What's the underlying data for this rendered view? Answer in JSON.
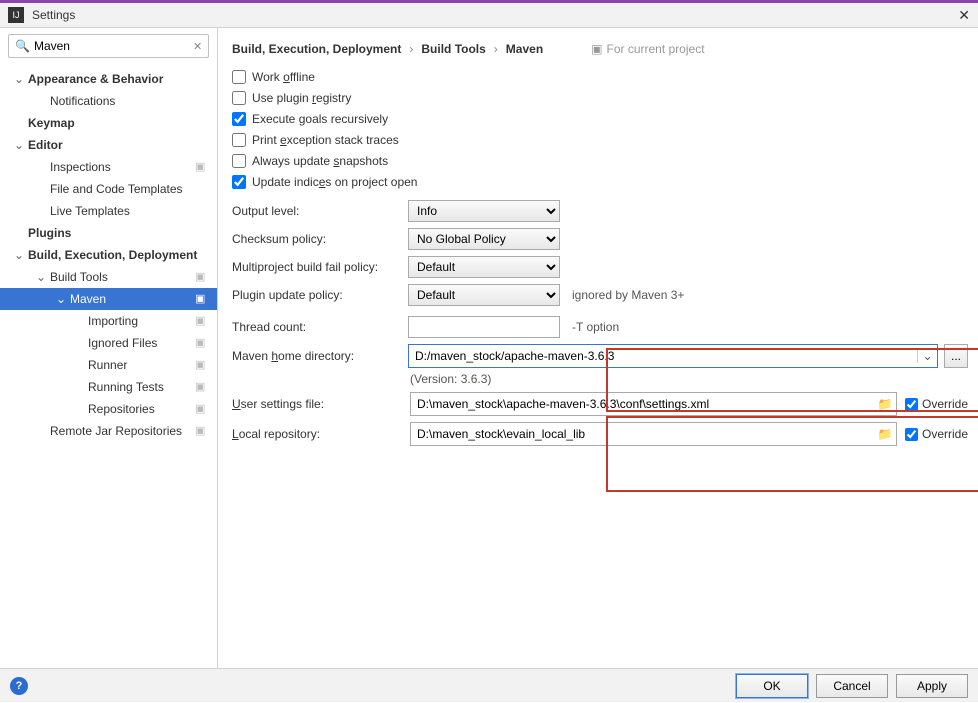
{
  "window": {
    "title": "Settings"
  },
  "search": {
    "value": "Maven",
    "placeholder": ""
  },
  "tree": {
    "appearance": "Appearance & Behavior",
    "notifications": "Notifications",
    "keymap": "Keymap",
    "editor": "Editor",
    "inspections": "Inspections",
    "file_templates": "File and Code Templates",
    "live_templates": "Live Templates",
    "plugins": "Plugins",
    "bed": "Build, Execution, Deployment",
    "build_tools": "Build Tools",
    "maven": "Maven",
    "importing": "Importing",
    "ignored": "Ignored Files",
    "runner": "Runner",
    "running_tests": "Running Tests",
    "repositories": "Repositories",
    "remote_jar": "Remote Jar Repositories"
  },
  "breadcrumb": {
    "b1": "Build, Execution, Deployment",
    "b2": "Build Tools",
    "b3": "Maven",
    "for_project": "For current project"
  },
  "checks": {
    "work_offline": "Work offline",
    "use_plugin_registry": "Use plugin registry",
    "execute_goals": "Execute goals recursively",
    "print_exception": "Print exception stack traces",
    "always_update": "Always update snapshots",
    "update_indices": "Update indices on project open"
  },
  "labels": {
    "output_level": "Output level:",
    "checksum_policy": "Checksum policy:",
    "multiproject": "Multiproject build fail policy:",
    "plugin_update": "Plugin update policy:",
    "thread_count": "Thread count:",
    "maven_home": "Maven home directory:",
    "user_settings": "User settings file:",
    "local_repo": "Local repository:",
    "override": "Override",
    "version": "(Version: 3.6.3)"
  },
  "values": {
    "output_level": "Info",
    "checksum_policy": "No Global Policy",
    "multiproject": "Default",
    "plugin_update": "Default",
    "plugin_update_hint": "ignored by Maven 3+",
    "thread_count": "",
    "thread_count_hint": "-T option",
    "maven_home": "D:/maven_stock/apache-maven-3.6.3",
    "user_settings": "D:\\maven_stock\\apache-maven-3.6.3\\conf\\settings.xml",
    "local_repo": "D:\\maven_stock\\evain_local_lib"
  },
  "checked": {
    "execute_goals": true,
    "update_indices": true,
    "override1": true,
    "override2": true
  },
  "footer": {
    "ok": "OK",
    "cancel": "Cancel",
    "apply": "Apply"
  }
}
